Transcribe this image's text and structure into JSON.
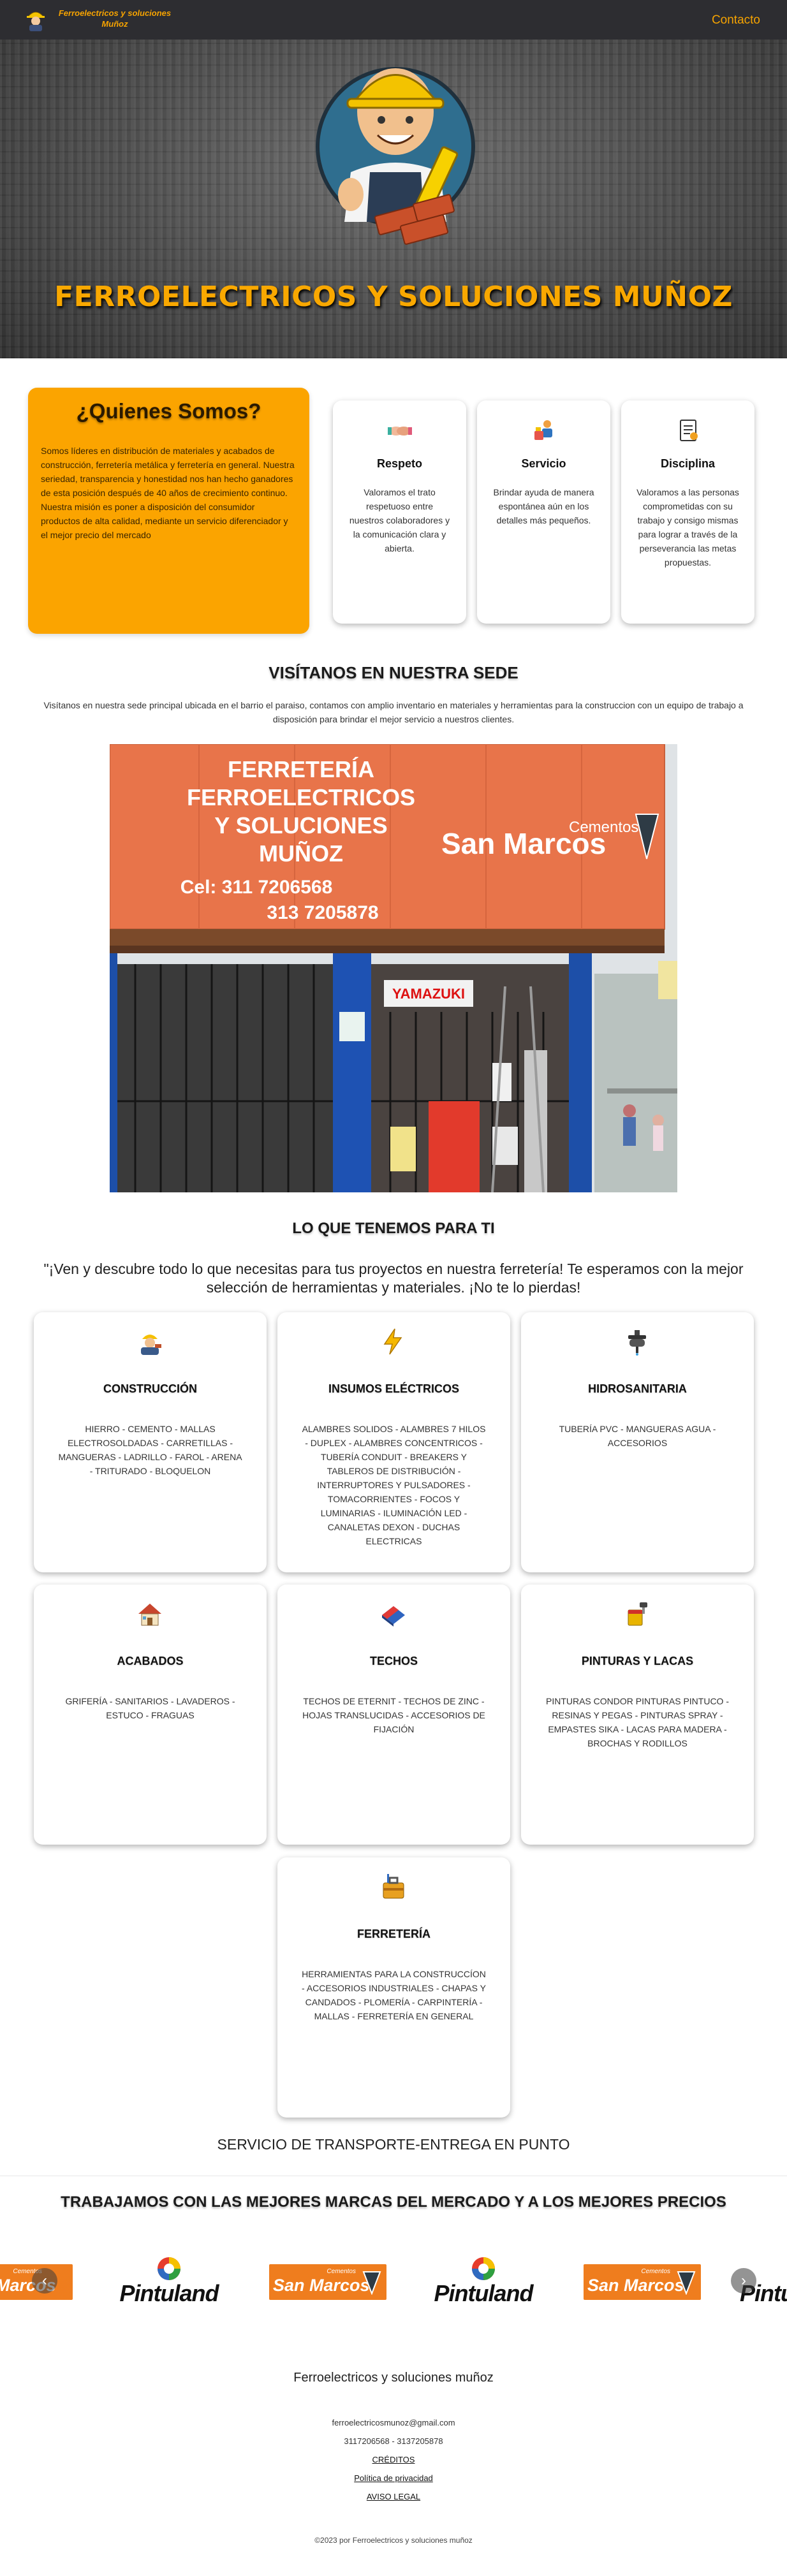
{
  "header": {
    "brand_line1": "Ferroelectricos y soluciones",
    "brand_line2": "Muñoz",
    "contact_label": "Contacto"
  },
  "hero": {
    "title": "FERROELECTRICOS Y SOLUCIONES MUÑOZ"
  },
  "about": {
    "title": "¿Quienes Somos?",
    "text": "Somos líderes en distribución de materiales y acabados de construcción, ferretería metálica y ferretería en general. Nuestra seriedad, transparencia y honestidad nos han hecho ganadores de esta posición después de 40 años de crecimiento continuo. Nuestra misión es poner a disposición del consumidor productos de alta calidad, mediante un servicio diferenciador y el mejor precio del mercado"
  },
  "values": [
    {
      "icon": "handshake-icon",
      "title": "Respeto",
      "text": "Valoramos el trato respetuoso entre nuestros colaboradores y la comunicación clara y abierta."
    },
    {
      "icon": "service-icon",
      "title": "Servicio",
      "text": "Brindar ayuda de manera espontánea aún en los detalles más pequeños."
    },
    {
      "icon": "checklist-icon",
      "title": "Disciplina",
      "text": "Valoramos a las personas comprometidas con su trabajo y consigo mismas para lograr a través de la perseverancia las metas propuestas."
    }
  ],
  "sede": {
    "title": "VISÍTANOS EN NUESTRA SEDE",
    "text": "Visítanos en nuestra sede principal ubicada en el barrio el paraiso, contamos con amplio inventario en materiales y herramientas para la construccion con un equipo de trabajo a disposición para brindar el mejor servicio a nuestros clientes.",
    "sign_line1": "FERRETERÍA",
    "sign_line2": "FERROELECTRICOS",
    "sign_line3": "Y SOLUCIONES",
    "sign_line4": "MUÑOZ",
    "sign_phone1": "Cel: 311 7206568",
    "sign_phone2": "313 7205878",
    "sign_brand_small": "Cementos",
    "sign_brand_big": "San Marcos",
    "shop_banner": "YAMAZUKI"
  },
  "products": {
    "title": "LO QUE TENEMOS PARA TI",
    "subtitle": "\"¡Ven y descubre todo lo que necesitas para tus proyectos en nuestra ferretería! Te esperamos con la mejor selección de herramientas y materiales. ¡No te lo pierdas!",
    "items": [
      {
        "icon": "worker-icon",
        "title": "CONSTRUCCIÓN",
        "text": "HIERRO - CEMENTO - MALLAS ELECTROSOLDADAS - CARRETILLAS - MANGUERAS - LADRILLO - FAROL - ARENA - TRITURADO - BLOQUELON"
      },
      {
        "icon": "lightning-icon",
        "title": "INSUMOS ELÉCTRICOS",
        "text": "ALAMBRES SOLIDOS - ALAMBRES 7 HILOS - DUPLEX - ALAMBRES CONCENTRICOS - TUBERÍA CONDUIT - BREAKERS Y TABLEROS DE DISTRIBUCIÓN - INTERRUPTORES Y PULSADORES - TOMACORRIENTES - FOCOS Y LUMINARIAS - ILUMINACIÓN LED - CANALETAS DEXON - DUCHAS ELECTRICAS"
      },
      {
        "icon": "faucet-icon",
        "title": "HIDROSANITARIA",
        "text": "TUBERÍA PVC - MANGUERAS AGUA - ACCESORIOS"
      },
      {
        "icon": "house-icon",
        "title": "ACABADOS",
        "text": "GRIFERÍA - SANITARIOS - LAVADEROS - ESTUCO - FRAGUAS"
      },
      {
        "icon": "roof-icon",
        "title": "TECHOS",
        "text": "TECHOS DE ETERNIT - TECHOS DE ZINC - HOJAS TRANSLUCIDAS - ACCESORIOS DE FIJACIÓN"
      },
      {
        "icon": "paint-bucket-icon",
        "title": "PINTURAS Y LACAS",
        "text": "PINTURAS CONDOR PINTURAS PINTUCO - RESINAS Y PEGAS - PINTURAS SPRAY - EMPASTES SIKA - LACAS PARA MADERA - BROCHAS Y RODILLOS"
      },
      {
        "icon": "toolbox-icon",
        "title": "FERRETERÍA",
        "text": "HERRAMIENTAS PARA LA CONSTRUCCÍON - ACCESORIOS INDUSTRIALES - CHAPAS Y CANDADOS - PLOMERÍA - CARPINTERÍA - MALLAS - FERRETERÍA EN GENERAL"
      }
    ]
  },
  "transport": "SERVICIO DE TRANSPORTE-ENTREGA EN PUNTO",
  "brands": {
    "title": "TRABAJAMOS CON LAS MEJORES MARCAS DEL MERCADO Y A LOS MEJORES PRECIOS",
    "sanmarcos_small": "Cementos",
    "sanmarcos_big": "San Marcos",
    "pintuland": "Pintuland",
    "prev": "‹",
    "next": "›"
  },
  "footer": {
    "name": "Ferroelectricos y soluciones muñoz",
    "email": "ferroelectricosmunoz@gmail.com",
    "phones": "3117206568 - 3137205878",
    "credits": "CRÉDITOS",
    "privacy": "Política de privacidad",
    "legal": "AVISO LEGAL",
    "copyright": "©2023 por Ferroelectricos y soluciones muñoz"
  },
  "colors": {
    "accent": "#f6a300",
    "header_bg": "#2d2d31",
    "about_bg": "#fba400"
  }
}
